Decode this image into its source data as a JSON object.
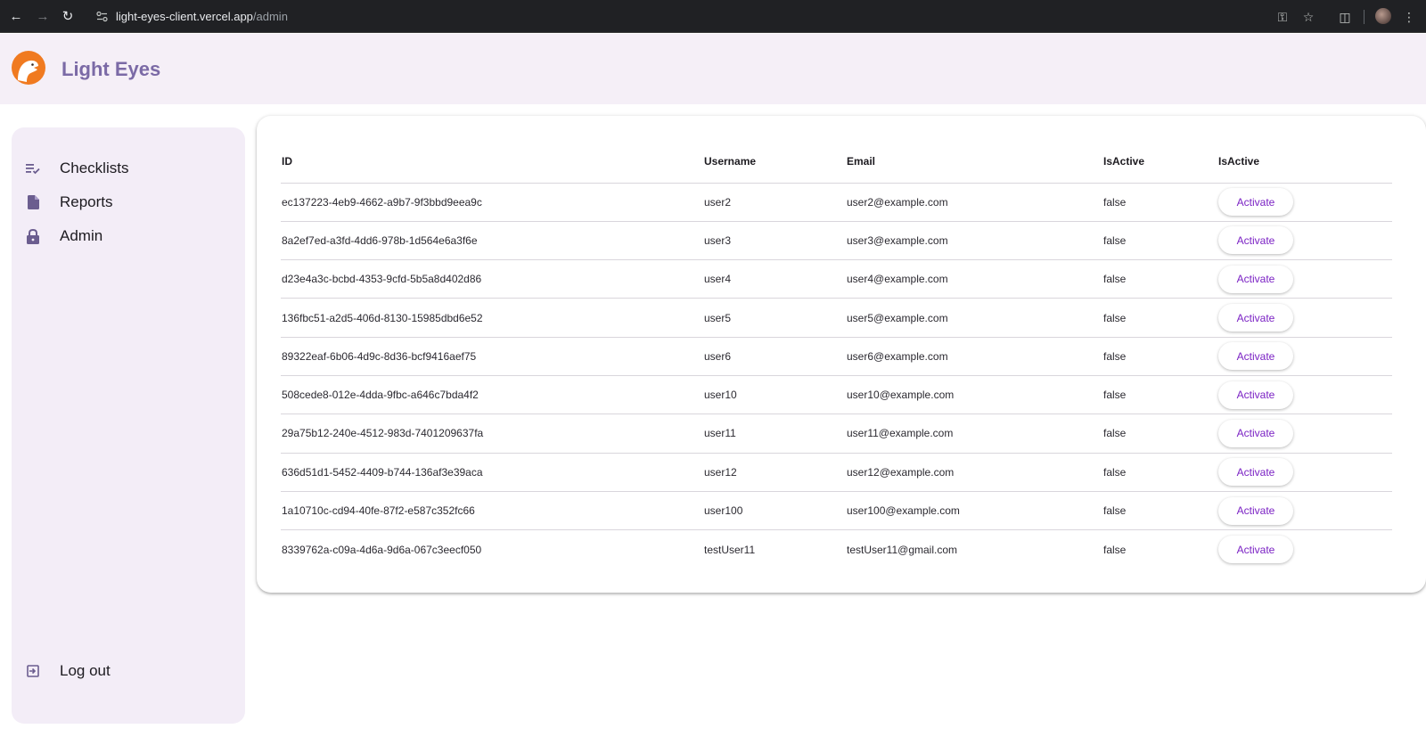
{
  "browser": {
    "url_host": "light-eyes-client.vercel.app",
    "url_path": "/admin"
  },
  "app": {
    "brand": "Light Eyes",
    "logo_icon": "eagle-logo-icon"
  },
  "sidebar": {
    "items": [
      {
        "label": "Checklists",
        "icon": "checklist-icon"
      },
      {
        "label": "Reports",
        "icon": "document-icon"
      },
      {
        "label": "Admin",
        "icon": "lock-icon"
      }
    ],
    "logout": {
      "label": "Log out",
      "icon": "logout-icon"
    }
  },
  "table": {
    "headers": [
      "ID",
      "Username",
      "Email",
      "IsActive",
      "IsActive"
    ],
    "action_label": "Activate",
    "rows": [
      {
        "id": "ec137223-4eb9-4662-a9b7-9f3bbd9eea9c",
        "username": "user2",
        "email": "user2@example.com",
        "active": "false"
      },
      {
        "id": "8a2ef7ed-a3fd-4dd6-978b-1d564e6a3f6e",
        "username": "user3",
        "email": "user3@example.com",
        "active": "false"
      },
      {
        "id": "d23e4a3c-bcbd-4353-9cfd-5b5a8d402d86",
        "username": "user4",
        "email": "user4@example.com",
        "active": "false"
      },
      {
        "id": "136fbc51-a2d5-406d-8130-15985dbd6e52",
        "username": "user5",
        "email": "user5@example.com",
        "active": "false"
      },
      {
        "id": "89322eaf-6b06-4d9c-8d36-bcf9416aef75",
        "username": "user6",
        "email": "user6@example.com",
        "active": "false"
      },
      {
        "id": "508cede8-012e-4dda-9fbc-a646c7bda4f2",
        "username": "user10",
        "email": "user10@example.com",
        "active": "false"
      },
      {
        "id": "29a75b12-240e-4512-983d-7401209637fa",
        "username": "user11",
        "email": "user11@example.com",
        "active": "false"
      },
      {
        "id": "636d51d1-5452-4409-b744-136af3e39aca",
        "username": "user12",
        "email": "user12@example.com",
        "active": "false"
      },
      {
        "id": "1a10710c-cd94-40fe-87f2-e587c352fc66",
        "username": "user100",
        "email": "user100@example.com",
        "active": "false"
      },
      {
        "id": "8339762a-c09a-4d6a-9d6a-067c3eecf050",
        "username": "testUser11",
        "email": "testUser11@gmail.com",
        "active": "false"
      }
    ]
  },
  "colors": {
    "header_bg": "#f5eff7",
    "sidebar_bg": "#f3edf7",
    "brand": "#7b6aa6",
    "accent": "#7b22c4"
  }
}
